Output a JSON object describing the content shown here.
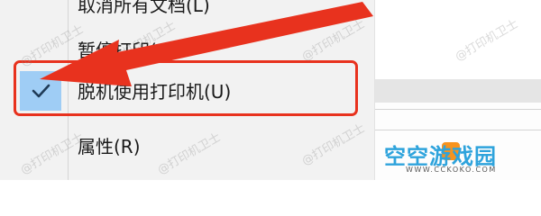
{
  "menu": {
    "items": [
      {
        "id": "cancel-all",
        "label": "取消所有文档(L)"
      },
      {
        "id": "pause",
        "label": "暂停打印(A)"
      },
      {
        "id": "offline",
        "label": "脱机使用打印机(U)",
        "checked": true
      },
      {
        "id": "properties",
        "label": "属性(R)"
      }
    ]
  },
  "watermark": {
    "text": "@打印机卫士"
  },
  "brand": {
    "name": "空空游戏园",
    "url": "WWW.CCKOKO.COM"
  },
  "colors": {
    "menu_bg": "#f2f2f2",
    "check_highlight": "#9fcdf5",
    "callout": "#e8321e",
    "brand": "#2ea3dc"
  },
  "icons": {
    "check": "check-icon",
    "arrow": "arrow-icon"
  }
}
